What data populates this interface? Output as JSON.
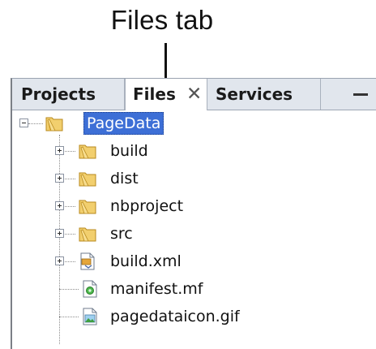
{
  "callout": {
    "label": "Files tab"
  },
  "tabs": [
    {
      "label": "Projects",
      "active": false
    },
    {
      "label": "Files",
      "active": true,
      "close_glyph": "✕"
    },
    {
      "label": "Services",
      "active": false
    }
  ],
  "minimize": {
    "icon": "minimize-icon"
  },
  "tree": {
    "root": {
      "label": "PageData",
      "icon": "folder-icon",
      "expanded": true,
      "selected": true
    },
    "children": [
      {
        "label": "build",
        "icon": "folder-icon",
        "expandable": true
      },
      {
        "label": "dist",
        "icon": "folder-icon",
        "expandable": true
      },
      {
        "label": "nbproject",
        "icon": "folder-icon",
        "expandable": true
      },
      {
        "label": "src",
        "icon": "folder-icon",
        "expandable": true
      },
      {
        "label": "build.xml",
        "icon": "ant-script-icon",
        "expandable": true
      },
      {
        "label": "manifest.mf",
        "icon": "manifest-file-icon",
        "expandable": false
      },
      {
        "label": "pagedataicon.gif",
        "icon": "image-file-icon",
        "expandable": false
      }
    ]
  },
  "colors": {
    "selection": "#3d6fd6",
    "tabbar": "#e1e6ed",
    "folder": "#e8b94a"
  }
}
